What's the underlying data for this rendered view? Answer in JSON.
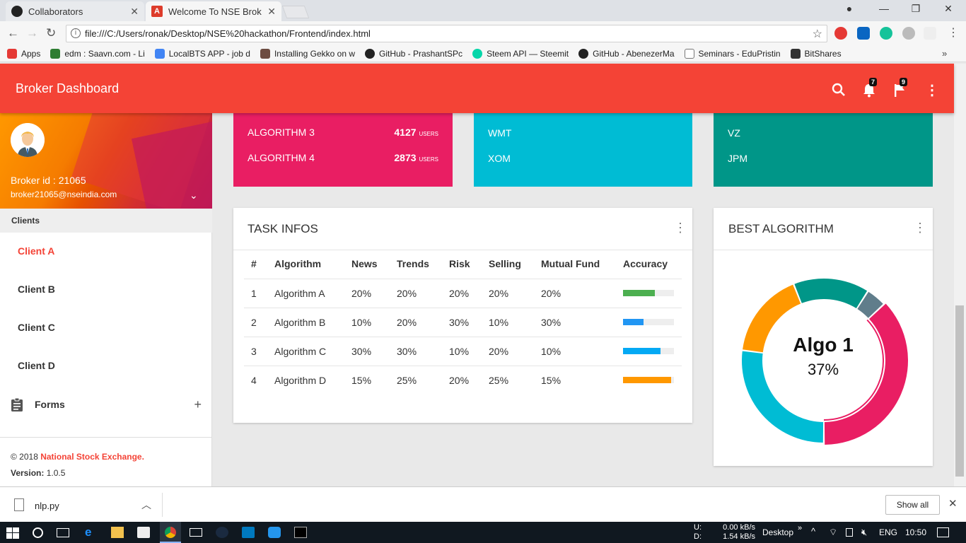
{
  "browser": {
    "tabs": [
      {
        "title": "Collaborators"
      },
      {
        "title": "Welcome To NSE Broker"
      }
    ],
    "active_tab_icon": "A",
    "url": "file:///C:/Users/ronak/Desktop/NSE%20hackathon/Frontend/index.html",
    "bookmarks": [
      {
        "label": "Apps",
        "icon": "apps-grid-icon"
      },
      {
        "label": "edm : Saavn.com - Li",
        "icon": "saavn-icon"
      },
      {
        "label": "LocalBTS APP - job d",
        "icon": "docs-icon"
      },
      {
        "label": "Installing Gekko on w",
        "icon": "gekko-icon"
      },
      {
        "label": "GitHub - PrashantSPc",
        "icon": "github-icon"
      },
      {
        "label": "Steem API — Steemit",
        "icon": "steemit-icon"
      },
      {
        "label": "GitHub - AbenezerMa",
        "icon": "github-icon"
      },
      {
        "label": "Seminars - EduPristin",
        "icon": "page-icon"
      },
      {
        "label": "BitShares",
        "icon": "bitshares-icon"
      }
    ],
    "more_bookmarks": "»"
  },
  "header": {
    "title": "Broker Dashboard",
    "notifications_count": "7",
    "flags_count": "9",
    "color": "#f44336"
  },
  "sidebar": {
    "broker_id": "Broker id : 21065",
    "email": "broker21065@nseindia.com",
    "section_label": "Clients",
    "clients": [
      "Client A",
      "Client B",
      "Client C",
      "Client D"
    ],
    "active_client": "Client A",
    "forms_label": "Forms",
    "footer_copyright": "© 2018",
    "footer_org": "National Stock Exchange.",
    "footer_version_label": "Version:",
    "footer_version": "1.0.5"
  },
  "info_boxes": [
    {
      "color": "#e91e63",
      "rows": [
        {
          "label": "ALGORITHM 3",
          "value": "4127",
          "unit": "USERS"
        },
        {
          "label": "ALGORITHM 4",
          "value": "2873",
          "unit": "USERS"
        }
      ]
    },
    {
      "color": "#00bcd4",
      "rows": [
        {
          "label": "WMT"
        },
        {
          "label": "XOM"
        }
      ]
    },
    {
      "color": "#009688",
      "rows": [
        {
          "label": "VZ"
        },
        {
          "label": "JPM"
        }
      ]
    }
  ],
  "task_infos": {
    "title": "TASK INFOS",
    "columns": [
      "#",
      "Algorithm",
      "News",
      "Trends",
      "Risk",
      "Selling",
      "Mutual Fund",
      "Accuracy"
    ],
    "rows": [
      {
        "n": "1",
        "algo": "Algorithm A",
        "news": "20%",
        "trends": "20%",
        "risk": "20%",
        "selling": "20%",
        "mf": "20%",
        "accuracy": 0.62,
        "color": "#4caf50"
      },
      {
        "n": "2",
        "algo": "Algorithm B",
        "news": "10%",
        "trends": "20%",
        "risk": "30%",
        "selling": "10%",
        "mf": "30%",
        "accuracy": 0.4,
        "color": "#2196f3"
      },
      {
        "n": "3",
        "algo": "Algorithm C",
        "news": "30%",
        "trends": "30%",
        "risk": "10%",
        "selling": "20%",
        "mf": "10%",
        "accuracy": 0.73,
        "color": "#03a9f4"
      },
      {
        "n": "4",
        "algo": "Algorithm D",
        "news": "15%",
        "trends": "25%",
        "risk": "20%",
        "selling": "25%",
        "mf": "15%",
        "accuracy": 0.95,
        "color": "#ff9800"
      }
    ]
  },
  "best_algorithm": {
    "title": "BEST ALGORITHM",
    "center_label": "Algo 1",
    "center_value": "37%"
  },
  "chart_data": {
    "type": "pie",
    "title": "BEST ALGORITHM",
    "slices": [
      {
        "value": 37,
        "color": "#e91e63"
      },
      {
        "value": 4,
        "color": "#607d8b"
      },
      {
        "value": 15,
        "color": "#009688"
      },
      {
        "value": 17,
        "color": "#ff9800"
      },
      {
        "value": 27,
        "color": "#00bcd4"
      }
    ]
  },
  "download_bar": {
    "file": "nlp.py",
    "show_all": "Show all"
  },
  "taskbar": {
    "upload_label": "U:",
    "download_label": "D:",
    "upload_speed": "0.00 kB/s",
    "download_speed": "1.54 kB/s",
    "desktop": "Desktop",
    "lang": "ENG",
    "time": "10:50"
  }
}
